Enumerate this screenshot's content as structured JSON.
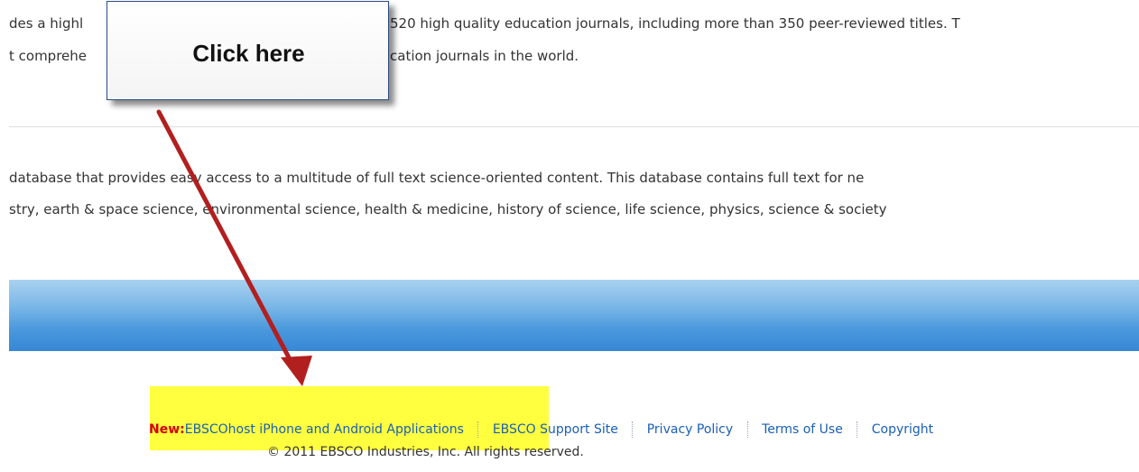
{
  "content": {
    "education_description": {
      "line1": "des a highly      (hidden)",
      "line1_left": "des a highl",
      "line1_right": "520 high quality education journals, including more than 350 peer-reviewed titles. T",
      "line2_left": "t comprehe",
      "line2_right": "cation journals in the world."
    },
    "science_description": {
      "line1": "database that provides easy access to a multitude of full text science-oriented content. This database contains full text for ne",
      "line2": "stry, earth & space science, environmental science, health & medicine, history of science, life science, physics, science & society"
    }
  },
  "callout": {
    "text": "Click here"
  },
  "footer": {
    "new_label": "New:",
    "links": {
      "mobile_apps": "EBSCOhost iPhone and Android Applications",
      "support_site": "EBSCO Support Site",
      "privacy_policy": "Privacy Policy",
      "terms_of_use": "Terms of Use",
      "copyright": "Copyright"
    },
    "copyright_notice": "© 2011 EBSCO Industries, Inc. All rights reserved."
  },
  "colors": {
    "callout_border": "#2a4a85",
    "arrow": "#b21f1f",
    "highlight": "#ffff40",
    "link": "#1a5fb4",
    "new_label": "#d40000",
    "blue_bar_top": "#a9d1ef",
    "blue_bar_bottom": "#3787d6"
  },
  "icons": {
    "arrow": "red-pointer-arrow-icon"
  }
}
